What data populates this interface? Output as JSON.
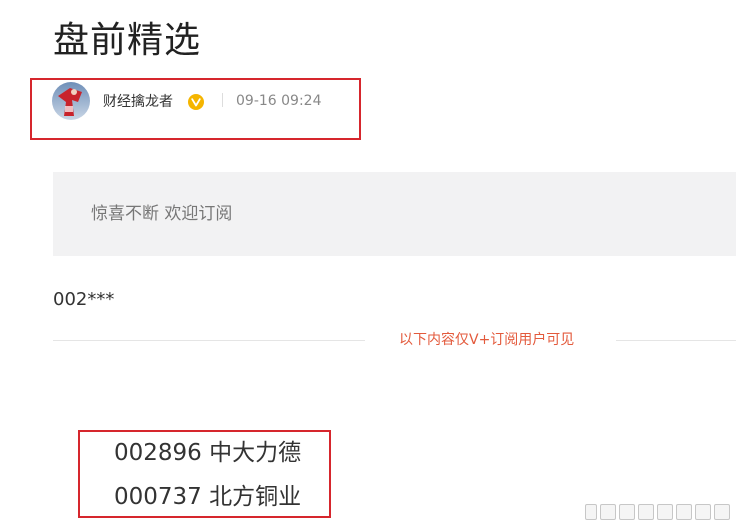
{
  "article": {
    "title": "盘前精选"
  },
  "author": {
    "name": "财经擒龙者",
    "verified_icon": "verified-v-badge-icon",
    "badge_color": "#f5b500",
    "post_time": "09-16 09:24"
  },
  "notice": {
    "text": "惊喜不断 欢迎订阅"
  },
  "content": {
    "code_preview": "002***",
    "paywall_label": "以下内容仅V+订阅用户可见",
    "stocks": [
      {
        "text": "002896 中大力德"
      },
      {
        "text": "000737 北方铜业"
      }
    ]
  },
  "colors": {
    "highlight_border": "#d6262d",
    "paywall_text": "#e35a3c",
    "notice_bg": "#f2f2f3"
  }
}
